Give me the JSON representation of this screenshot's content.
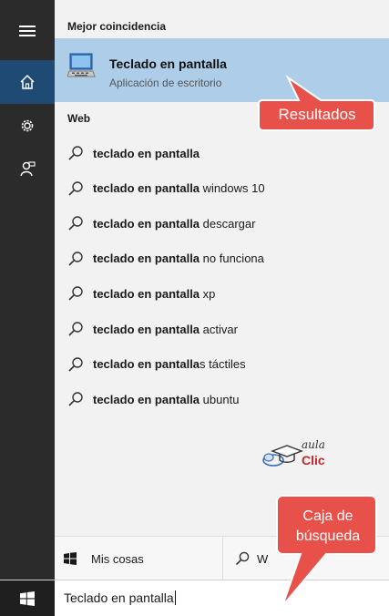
{
  "sidebar": {
    "items": [
      {
        "icon": "hamburger-menu-icon",
        "active": false
      },
      {
        "icon": "home-icon",
        "active": true
      },
      {
        "icon": "settings-gear-icon",
        "active": false
      },
      {
        "icon": "feedback-person-icon",
        "active": false
      }
    ]
  },
  "best_match": {
    "heading": "Mejor coincidencia",
    "title": "Teclado en pantalla",
    "subtitle": "Aplicación de escritorio",
    "icon": "on-screen-keyboard-app-icon"
  },
  "web": {
    "heading": "Web",
    "results": [
      {
        "bold": "teclado en pantalla",
        "rest": ""
      },
      {
        "bold": "teclado en pantalla",
        "rest": " windows 10"
      },
      {
        "bold": "teclado en pantalla",
        "rest": " descargar"
      },
      {
        "bold": "teclado en pantalla",
        "rest": " no funciona"
      },
      {
        "bold": "teclado en pantalla",
        "rest": " xp"
      },
      {
        "bold": "teclado en pantalla",
        "rest": " activar"
      },
      {
        "bold": "teclado en pantalla",
        "rest": "s táctiles"
      },
      {
        "bold": "teclado en pantalla",
        "rest": " ubuntu"
      }
    ]
  },
  "logo": {
    "top": "aula",
    "bottom": "Clic"
  },
  "bottom": {
    "my_stuff_label": "Mis cosas",
    "web_label": "W"
  },
  "search": {
    "query": "Teclado en pantalla"
  },
  "annotations": {
    "results_label": "Resultados",
    "searchbox_line1": "Caja de",
    "searchbox_line2": "búsqueda"
  },
  "colors": {
    "rail": "#2b2b2b",
    "rail_active": "#1f4a73",
    "best_match_bg": "#aecde8",
    "callout_fill": "#e8504a",
    "logo_red": "#c0272d"
  }
}
